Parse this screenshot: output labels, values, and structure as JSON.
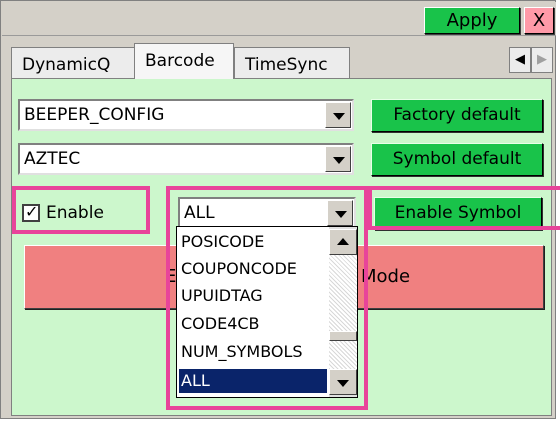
{
  "topbar": {
    "apply_label": "Apply",
    "close_label": "X"
  },
  "tabs": [
    {
      "label": "DynamicQ"
    },
    {
      "label": "Barcode",
      "active": true
    },
    {
      "label": "TimeSync"
    }
  ],
  "tab_scroll": {
    "left_icon": "◀",
    "right_icon": "▶"
  },
  "config": {
    "selected_config": "BEEPER_CONFIG",
    "factory_default_label": "Factory default",
    "selected_symbol": "AZTEC",
    "symbol_default_label": "Symbol default"
  },
  "symbol": {
    "enable_label": "Enable",
    "enable_checked": true,
    "check_glyph": "✓",
    "selected": "ALL",
    "enable_symbol_label": "Enable Symbol"
  },
  "big_button": {
    "label_left": "E",
    "label_right": "Mode"
  },
  "dropdown": {
    "items": [
      "POSICODE",
      "COUPONCODE",
      "UPUIDTAG",
      "CODE4CB",
      "NUM_SYMBOLS",
      "ALL"
    ],
    "selected_index": 5
  },
  "colors": {
    "green_button": "#19c34a",
    "panel_bg": "#ccf7cc",
    "big_button": "#f08080",
    "highlight": "#e8449a",
    "close_button": "#ff9aa8",
    "selection": "#0a246a"
  }
}
